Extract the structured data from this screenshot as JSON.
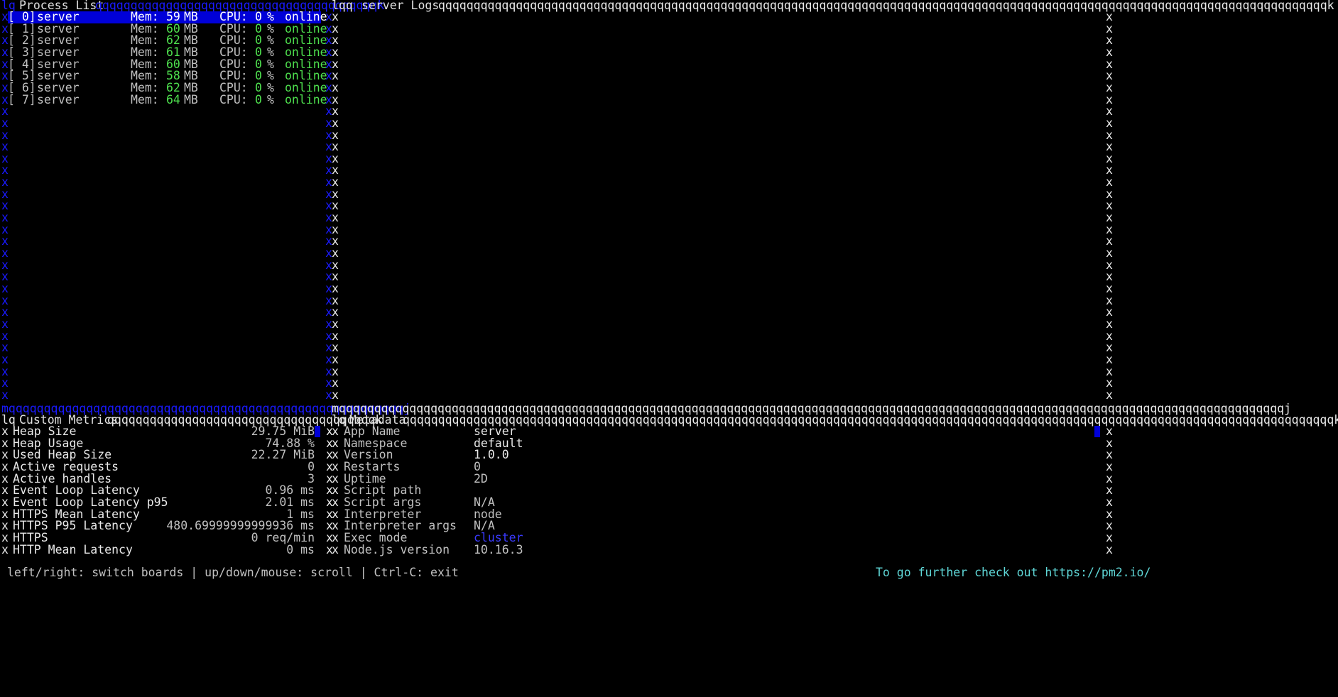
{
  "process_list": {
    "title": "Process List",
    "rows": [
      {
        "id": "[ 0]",
        "name": "server",
        "mem_label": "Mem:",
        "mem": "59",
        "mem_unit": "MB",
        "cpu_label": "CPU:",
        "cpu": "0",
        "cpu_unit": "%",
        "status": "online",
        "selected": true
      },
      {
        "id": "[ 1]",
        "name": "server",
        "mem_label": "Mem:",
        "mem": "60",
        "mem_unit": "MB",
        "cpu_label": "CPU:",
        "cpu": "0",
        "cpu_unit": "%",
        "status": "online",
        "selected": false
      },
      {
        "id": "[ 2]",
        "name": "server",
        "mem_label": "Mem:",
        "mem": "62",
        "mem_unit": "MB",
        "cpu_label": "CPU:",
        "cpu": "0",
        "cpu_unit": "%",
        "status": "online",
        "selected": false
      },
      {
        "id": "[ 3]",
        "name": "server",
        "mem_label": "Mem:",
        "mem": "61",
        "mem_unit": "MB",
        "cpu_label": "CPU:",
        "cpu": "0",
        "cpu_unit": "%",
        "status": "online",
        "selected": false
      },
      {
        "id": "[ 4]",
        "name": "server",
        "mem_label": "Mem:",
        "mem": "60",
        "mem_unit": "MB",
        "cpu_label": "CPU:",
        "cpu": "0",
        "cpu_unit": "%",
        "status": "online",
        "selected": false
      },
      {
        "id": "[ 5]",
        "name": "server",
        "mem_label": "Mem:",
        "mem": "58",
        "mem_unit": "MB",
        "cpu_label": "CPU:",
        "cpu": "0",
        "cpu_unit": "%",
        "status": "online",
        "selected": false
      },
      {
        "id": "[ 6]",
        "name": "server",
        "mem_label": "Mem:",
        "mem": "62",
        "mem_unit": "MB",
        "cpu_label": "CPU:",
        "cpu": "0",
        "cpu_unit": "%",
        "status": "online",
        "selected": false
      },
      {
        "id": "[ 7]",
        "name": "server",
        "mem_label": "Mem:",
        "mem": "64",
        "mem_unit": "MB",
        "cpu_label": "CPU:",
        "cpu": "0",
        "cpu_unit": "%",
        "status": "online",
        "selected": false
      }
    ]
  },
  "logs": {
    "title": "server Logs"
  },
  "custom_metrics": {
    "title": "Custom Metrics",
    "rows": [
      {
        "label": "Heap Size",
        "value": "29.75 MiB"
      },
      {
        "label": "Heap Usage",
        "value": "74.88 %"
      },
      {
        "label": "Used Heap Size",
        "value": "22.27 MiB"
      },
      {
        "label": "Active requests",
        "value": "0"
      },
      {
        "label": "Active handles",
        "value": "3"
      },
      {
        "label": "Event Loop Latency",
        "value": "0.96 ms"
      },
      {
        "label": "Event Loop Latency p95",
        "value": "2.01 ms"
      },
      {
        "label": "HTTPS Mean Latency",
        "value": "1 ms"
      },
      {
        "label": "HTTPS P95 Latency",
        "value": "480.69999999999936 ms"
      },
      {
        "label": "HTTPS",
        "value": "0 req/min"
      },
      {
        "label": "HTTP Mean Latency",
        "value": "0 ms"
      }
    ]
  },
  "metadata": {
    "title": "Metadata",
    "rows": [
      {
        "label": "App Name",
        "value": "server"
      },
      {
        "label": "Namespace",
        "value": "default"
      },
      {
        "label": "Version",
        "value": "1.0.0"
      },
      {
        "label": "Restarts",
        "value": "0"
      },
      {
        "label": "Uptime",
        "value": "2D"
      },
      {
        "label": "Script path",
        "value": ""
      },
      {
        "label": "Script args",
        "value": "N/A"
      },
      {
        "label": "Interpreter",
        "value": "node"
      },
      {
        "label": "Interpreter args",
        "value": "N/A"
      },
      {
        "label": "Exec mode",
        "value": "cluster"
      },
      {
        "label": "Node.js version",
        "value": "10.16.3"
      }
    ]
  },
  "footer": {
    "help": "left/right: switch boards | up/down/mouse: scroll | Ctrl-C: exit",
    "link_text": "To go further check out https://pm2.io/"
  },
  "colors": {
    "border": "#1a1aff",
    "selection": "#0000d8",
    "online": "#4ee04e",
    "link": "#5fd7d7"
  }
}
